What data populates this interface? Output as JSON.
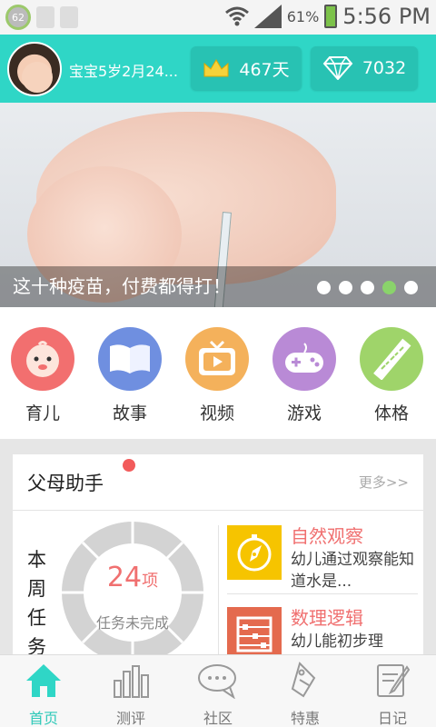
{
  "status_bar": {
    "notification_badge": "62",
    "battery": "61%",
    "time": "5:56 PM"
  },
  "header": {
    "baby_age": "宝宝5岁2月24...",
    "days": "467天",
    "gems": "7032"
  },
  "banner": {
    "caption": "这十种疫苗，付费都得打！",
    "slide_count": 5,
    "active_slide": 4
  },
  "categories": [
    {
      "label": "育儿",
      "icon": "baby-face-icon",
      "color": "#f26f6f"
    },
    {
      "label": "故事",
      "icon": "book-icon",
      "color": "#6f8fe0"
    },
    {
      "label": "视频",
      "icon": "tv-icon",
      "color": "#f4b15b"
    },
    {
      "label": "游戏",
      "icon": "gamepad-icon",
      "color": "#b98ad6"
    },
    {
      "label": "体格",
      "icon": "ruler-icon",
      "color": "#9fd46a"
    }
  ],
  "parent_helper": {
    "title": "父母助手",
    "more": "更多>>",
    "tasks_label": "本周任务",
    "task_count": "24",
    "task_unit": "项",
    "task_status": "任务未完成",
    "items": [
      {
        "title": "自然观察",
        "desc": "幼儿通过观察能知道水是...",
        "icon": "compass-icon",
        "color": "#f6c400"
      },
      {
        "title": "数理逻辑",
        "desc": "幼儿能初步理",
        "icon": "abacus-icon",
        "color": "#e46a4e"
      }
    ]
  },
  "bottom_nav": [
    {
      "label": "首页",
      "icon": "home-icon",
      "active": true
    },
    {
      "label": "测评",
      "icon": "bar-chart-icon",
      "active": false
    },
    {
      "label": "社区",
      "icon": "chat-bubble-icon",
      "active": false
    },
    {
      "label": "特惠",
      "icon": "price-tag-icon",
      "active": false
    },
    {
      "label": "日记",
      "icon": "diary-icon",
      "active": false
    }
  ]
}
